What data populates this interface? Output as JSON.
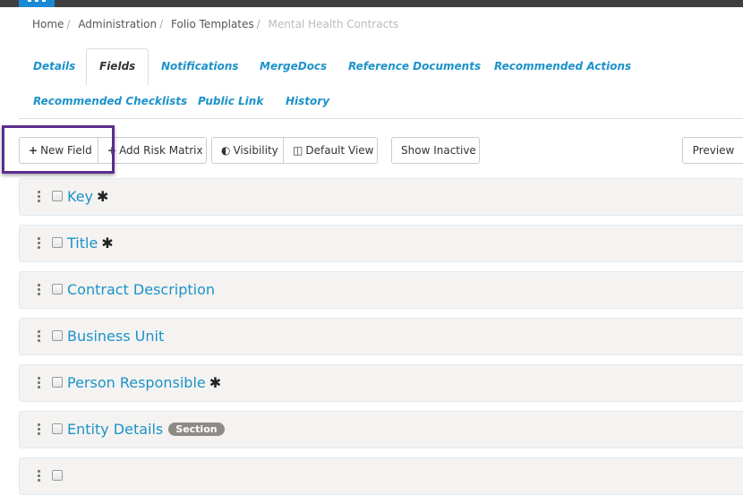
{
  "breadcrumb": {
    "items": [
      "Home",
      "Administration",
      "Folio Templates"
    ],
    "current": "Mental Health Contracts",
    "separator": "/"
  },
  "tabs": [
    {
      "label": "Details",
      "active": false
    },
    {
      "label": "Fields",
      "active": true
    },
    {
      "label": "Notifications",
      "active": false
    },
    {
      "label": "MergeDocs",
      "active": false
    },
    {
      "label": "Reference Documents",
      "active": false
    },
    {
      "label": "Recommended Actions",
      "active": false
    },
    {
      "label": "Recommended Checklists",
      "active": false
    },
    {
      "label": "Public Link",
      "active": false
    },
    {
      "label": "History",
      "active": false
    }
  ],
  "toolbar": {
    "new_field": "New Field",
    "add_risk_matrix": "Add Risk Matrix",
    "visibility": "Visibility",
    "default_view": "Default View",
    "show_inactive": "Show Inactive",
    "preview": "Preview",
    "plus_icon": "+",
    "visibility_icon": "◐",
    "columns_icon": "◫"
  },
  "fields": [
    {
      "label": "Key",
      "required": true,
      "badge": null
    },
    {
      "label": "Title",
      "required": true,
      "badge": null
    },
    {
      "label": "Contract Description",
      "required": false,
      "badge": null
    },
    {
      "label": "Business Unit",
      "required": false,
      "badge": null
    },
    {
      "label": "Person Responsible",
      "required": true,
      "badge": null
    },
    {
      "label": "Entity Details",
      "required": false,
      "badge": "Section"
    },
    {
      "label": "",
      "required": false,
      "badge": null
    }
  ],
  "required_marker": "✱",
  "highlight_color": "#5b2d8e",
  "link_color": "#1c92c9"
}
